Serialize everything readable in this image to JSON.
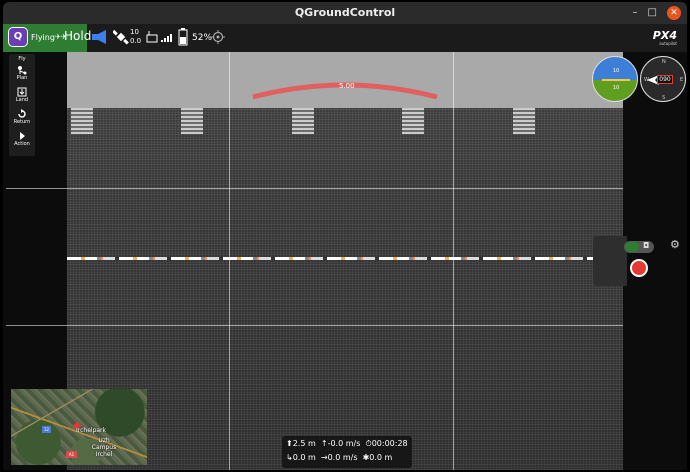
{
  "window": {
    "title": "QGroundControl",
    "minimize": "–",
    "maximize": "□",
    "close": "✕"
  },
  "toolbar": {
    "app_icon": "qgc-logo-icon",
    "flight_status": "Flying",
    "flight_mode": "Hold",
    "gps_count": "10",
    "gps_hdop": "0.0",
    "battery_percent": "52%",
    "brand": "PX4",
    "brand_sub": "autopilot",
    "accent_color": "#2e7d32"
  },
  "tools": [
    {
      "label": "Fly",
      "icon": "fly-icon"
    },
    {
      "label": "Plan",
      "icon": "plan-icon"
    },
    {
      "label": "Land",
      "icon": "land-icon"
    },
    {
      "label": "Return",
      "icon": "return-icon"
    },
    {
      "label": "Action",
      "icon": "action-icon"
    }
  ],
  "video": {
    "heading_indicator": "5.00"
  },
  "instruments": {
    "attitude_upper": "10",
    "attitude_lower": "10",
    "compass_heading": "090",
    "compass_n": "N",
    "compass_e": "E",
    "compass_s": "S",
    "compass_w": "W"
  },
  "map": {
    "label_park": "Irchelpark",
    "label_campus": "Uzh Campus Irchel",
    "badge_road": "12",
    "badge_motorway": "A1"
  },
  "telemetry": {
    "altitude": "2.5 m",
    "vertical_speed": "-0.0 m/s",
    "flight_time": "00:00:28",
    "distance_home": "0.0 m",
    "horizontal_speed": "0.0 m/s",
    "distance_gcs": "0.0 m"
  }
}
